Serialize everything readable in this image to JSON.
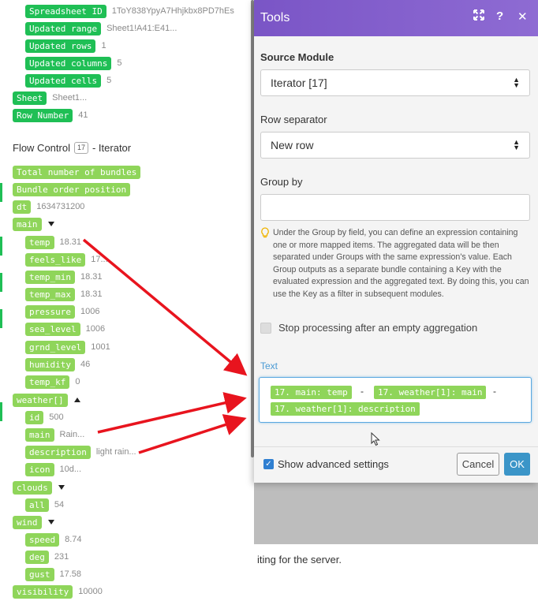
{
  "status_text": "iting for the server.",
  "mapping": {
    "top_items": [
      {
        "label": "Spreadsheet ID",
        "value": "1ToY838YpyA7Hhjkbx8PD7hEs"
      },
      {
        "label": "Updated range",
        "value": "Sheet1!A41:E41..."
      },
      {
        "label": "Updated rows",
        "value": "1"
      },
      {
        "label": "Updated columns",
        "value": "5"
      },
      {
        "label": "Updated cells",
        "value": "5"
      }
    ],
    "sheet": {
      "label": "Sheet",
      "value": "Sheet1..."
    },
    "row_number": {
      "label": "Row Number",
      "value": "41"
    },
    "section": {
      "title": "Flow Control",
      "badge": "17",
      "subtitle": "- Iterator"
    },
    "bundles": {
      "label": "Total number of bundles"
    },
    "order": {
      "label": "Bundle order position"
    },
    "dt": {
      "label": "dt",
      "value": "1634731200"
    },
    "main": {
      "label": "main"
    },
    "main_items": [
      {
        "label": "temp",
        "value": "18.31"
      },
      {
        "label": "feels_like",
        "value": "17..."
      },
      {
        "label": "temp_min",
        "value": "18.31"
      },
      {
        "label": "temp_max",
        "value": "18.31"
      },
      {
        "label": "pressure",
        "value": "1006"
      },
      {
        "label": "sea_level",
        "value": "1006"
      },
      {
        "label": "grnd_level",
        "value": "1001"
      },
      {
        "label": "humidity",
        "value": "46"
      },
      {
        "label": "temp_kf",
        "value": "0"
      }
    ],
    "weather": {
      "label": "weather[]"
    },
    "weather_items": [
      {
        "label": "id",
        "value": "500"
      },
      {
        "label": "main",
        "value": "Rain..."
      },
      {
        "label": "description",
        "value": "light rain..."
      },
      {
        "label": "icon",
        "value": "10d..."
      }
    ],
    "clouds": {
      "label": "clouds"
    },
    "clouds_all": {
      "label": "all",
      "value": "54"
    },
    "wind": {
      "label": "wind"
    },
    "wind_items": [
      {
        "label": "speed",
        "value": "8.74"
      },
      {
        "label": "deg",
        "value": "231"
      },
      {
        "label": "gust",
        "value": "17.58"
      }
    ],
    "visibility": {
      "label": "visibility",
      "value": "10000"
    }
  },
  "dialog": {
    "title": "Tools",
    "source_module_label": "Source Module",
    "source_module_value": "Iterator [17]",
    "row_separator_label": "Row separator",
    "row_separator_value": "New row",
    "group_by_label": "Group by",
    "help_text": "Under the Group by field, you can define an expression containing one or more mapped items. The aggregated data will be then separated under Groups with the same expression's value. Each Group outputs as a separate bundle containing a Key with the evaluated expression and the aggregated text. By doing this, you can use the Key as a filter in subsequent modules.",
    "stop_processing_label": "Stop processing after an empty aggregation",
    "text_label": "Text",
    "text_tokens": {
      "t1": "17. main: temp",
      "t2": "17. weather[1]: main",
      "t3": "17. weather[1]: description",
      "sep": "-"
    },
    "show_advanced_label": "Show advanced settings",
    "cancel_label": "Cancel",
    "ok_label": "OK"
  },
  "colors": {
    "header": "#7a55c6",
    "pill_dark": "#1fbf55",
    "pill_light": "#8fd55a",
    "ok_button": "#3b95c8",
    "arrow": "#e8141e"
  },
  "icons": [
    "expand-icon",
    "help-icon",
    "close-icon",
    "lightbulb-icon",
    "mouse-cursor-icon"
  ]
}
